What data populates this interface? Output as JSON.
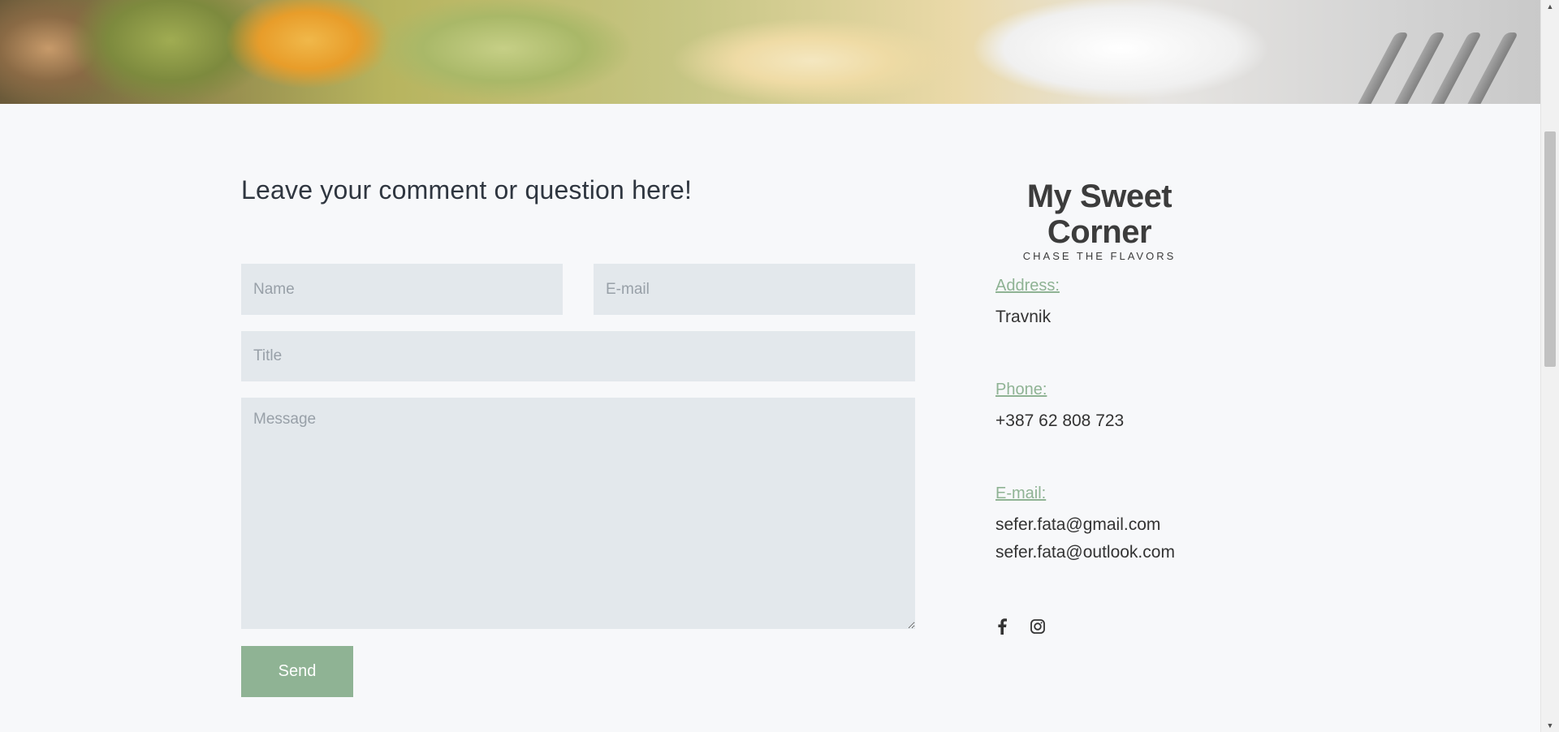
{
  "form": {
    "heading": "Leave your comment or question here!",
    "name_placeholder": "Name",
    "email_placeholder": "E-mail",
    "title_placeholder": "Title",
    "message_placeholder": "Message",
    "send_label": "Send"
  },
  "brand": {
    "name": "My Sweet Corner",
    "tagline": "CHASE THE FLAVORS"
  },
  "contact": {
    "address_label": "Address:",
    "address_value": "Travnik",
    "phone_label": "Phone:",
    "phone_value": "+387 62 808 723",
    "email_label": "E-mail:",
    "emails": [
      "sefer.fata@gmail.com",
      "sefer.fata@outlook.com"
    ]
  },
  "social": {
    "icons": [
      "facebook-icon",
      "instagram-icon"
    ]
  },
  "colors": {
    "accent": "#8fb394",
    "background": "#f7f8fa",
    "field": "#e3e8ec",
    "text": "#2f3640"
  }
}
